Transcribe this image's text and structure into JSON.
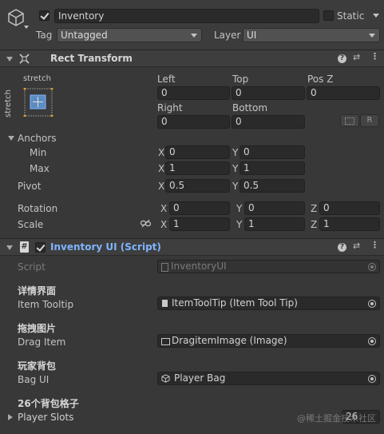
{
  "gameobject": {
    "name": "Inventory",
    "active": true,
    "static_label": "Static",
    "static": false,
    "tag_label": "Tag",
    "tag_value": "Untagged",
    "layer_label": "Layer",
    "layer_value": "UI"
  },
  "rect_transform": {
    "title": "Rect Transform",
    "anchor_preset_h": "stretch",
    "anchor_preset_v": "stretch",
    "row1": {
      "left_label": "Left",
      "top_label": "Top",
      "posz_label": "Pos Z",
      "left": "0",
      "top": "0",
      "posz": "0"
    },
    "row2": {
      "right_label": "Right",
      "bottom_label": "Bottom",
      "right": "0",
      "bottom": "0"
    },
    "raw_btn": "R",
    "anchors_label": "Anchors",
    "min_label": "Min",
    "max_label": "Max",
    "pivot_label": "Pivot",
    "axis_x": "X",
    "axis_y": "Y",
    "axis_z": "Z",
    "min": {
      "x": "0",
      "y": "0"
    },
    "max": {
      "x": "1",
      "y": "1"
    },
    "pivot": {
      "x": "0.5",
      "y": "0.5"
    },
    "rotation_label": "Rotation",
    "rotation": {
      "x": "0",
      "y": "0",
      "z": "0"
    },
    "scale_label": "Scale",
    "scale": {
      "x": "1",
      "y": "1",
      "z": "1"
    }
  },
  "script_component": {
    "title": "Inventory UI (Script)",
    "enabled": true,
    "script_label": "Script",
    "script_value": "InventoryUI",
    "header1": "详情界面",
    "item_tooltip_label": "Item Tooltip",
    "item_tooltip_value": "ItemToolTip (Item Tool Tip)",
    "header2": "拖拽图片",
    "drag_item_label": "Drag Item",
    "drag_item_value": "DragitemImage (Image)",
    "header3": "玩家背包",
    "bag_ui_label": "Bag UI",
    "bag_ui_value": "Player Bag",
    "header4": "26个背包格子",
    "player_slots_label": "Player Slots",
    "player_slots_value": "26"
  },
  "watermark": "@稀土掘金技术社区",
  "colors": {
    "accent_blue": "#7fb4ff",
    "background": "#383838",
    "field": "#2a2a2a"
  }
}
